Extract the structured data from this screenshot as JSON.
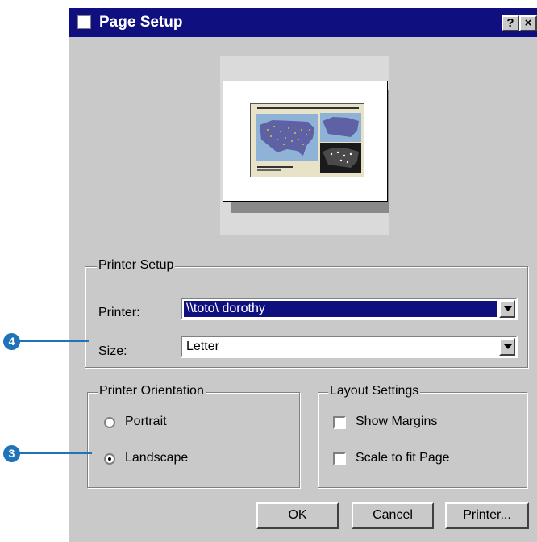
{
  "window": {
    "title": "Page Setup",
    "help_label": "?",
    "close_label": "×"
  },
  "printer_setup": {
    "legend": "Printer Setup",
    "printer_label": "Printer:",
    "printer_value": "\\\\toto\\ dorothy",
    "size_label": "Size:",
    "size_value": "Letter"
  },
  "orientation": {
    "legend": "Printer Orientation",
    "options": [
      {
        "label": "Portrait",
        "checked": false
      },
      {
        "label": "Landscape",
        "checked": true
      }
    ]
  },
  "layout_settings": {
    "legend": "Layout Settings",
    "options": [
      {
        "label": "Show Margins",
        "checked": false
      },
      {
        "label": "Scale to fit Page",
        "checked": false
      }
    ]
  },
  "buttons": {
    "ok": "OK",
    "cancel": "Cancel",
    "printer": "Printer..."
  },
  "callouts": {
    "size": "4",
    "orientation": "3"
  },
  "colors": {
    "title_bar": "#0f0f7f",
    "dialog_bg": "#c9c9c9",
    "callout": "#1e73ba"
  }
}
